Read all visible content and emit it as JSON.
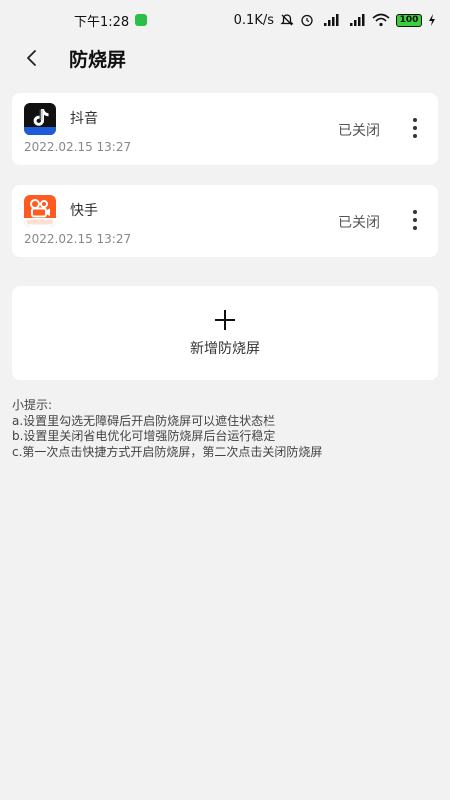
{
  "status_bar": {
    "time": "下午1:28",
    "network_speed": "0.1K/s",
    "battery": "100"
  },
  "header": {
    "title": "防烧屏"
  },
  "apps": [
    {
      "name": "抖音",
      "date": "2022.02.15 13:27",
      "status": "已关闭",
      "icon": "douyin-icon",
      "icon_color": "#111111"
    },
    {
      "name": "快手",
      "date": "2022.02.15 13:27",
      "status": "已关闭",
      "icon": "kuaishou-icon",
      "icon_color": "#ff5a1f"
    }
  ],
  "add_button": {
    "label": "新增防烧屏"
  },
  "tips": {
    "title": "小提示:",
    "lines": [
      "a.设置里勾选无障碍后开启防烧屏可以遮住状态栏",
      "b.设置里关闭省电优化可增强防烧屏后台运行稳定",
      "c.第一次点击快捷方式开启防烧屏，第二次点击关闭防烧屏"
    ]
  }
}
